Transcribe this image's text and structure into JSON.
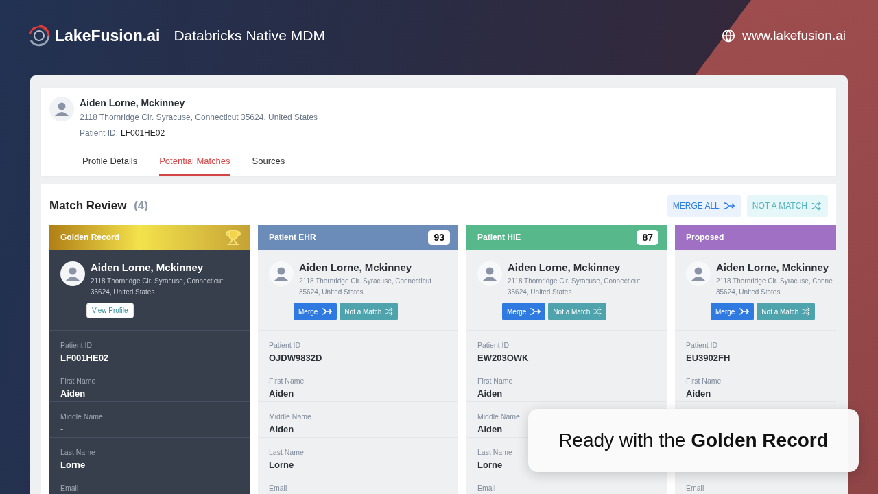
{
  "brand": {
    "name": "LakeFusion.ai",
    "tagline": "Databricks Native MDM",
    "website": "www.lakefusion.ai"
  },
  "profile": {
    "name": "Aiden Lorne, Mckinney",
    "address": "2118 Thornridge Cir. Syracuse, Connecticut 35624, United States",
    "id_label": "Patient ID:",
    "id_value": "LF001HE02"
  },
  "tabs": [
    {
      "label": "Profile Details",
      "selected": false
    },
    {
      "label": "Potential Matches",
      "selected": true
    },
    {
      "label": "Sources",
      "selected": false
    }
  ],
  "match_review": {
    "title": "Match Review",
    "count": "(4)",
    "actions": [
      {
        "kind": "merge",
        "label": "MERGE ALL"
      },
      {
        "kind": "reject",
        "label": "NOT A MATCH"
      }
    ]
  },
  "cards": [
    {
      "kind": "golden",
      "title": "Golden Record",
      "color": "#c9a227",
      "name": "Aiden Lorne, Mckinney",
      "name_underlined": false,
      "address_lines": [
        "2118 Thornridge Cir. Syracuse, Connecticut",
        "35624, United States"
      ],
      "button": "View Profile",
      "fields": [
        {
          "label": "Patient ID",
          "value": "LF001HE02"
        },
        {
          "label": "First Name",
          "value": "Aiden"
        },
        {
          "label": "Middle Name",
          "value": "-"
        },
        {
          "label": "Last Name",
          "value": "Lorne"
        },
        {
          "label": "Email"
        }
      ]
    },
    {
      "kind": "source",
      "title": "Patient EHR",
      "color": "#6b8bb8",
      "score": "93",
      "name": "Aiden Lorne, Mckinney",
      "name_underlined": false,
      "address_lines": [
        "2118 Thornridge Cir. Syracuse, Connecticut",
        "35624, United States"
      ],
      "merge": "Merge",
      "reject": "Not a Match",
      "fields": [
        {
          "label": "Patient ID",
          "value": "OJDW9832D"
        },
        {
          "label": "First Name",
          "value": "Aiden"
        },
        {
          "label": "Middle Name",
          "value": "Aiden"
        },
        {
          "label": "Last Name",
          "value": "Lorne"
        },
        {
          "label": "Email"
        }
      ]
    },
    {
      "kind": "source",
      "title": "Patient HIE",
      "color": "#57b88c",
      "score": "87",
      "name": "Aiden Lorne, Mckinney",
      "name_underlined": true,
      "address_lines": [
        "2118 Thornridge Cir. Syracuse, Connecticut",
        "35624, United States"
      ],
      "merge": "Merge",
      "reject": "Not a Match",
      "fields": [
        {
          "label": "Patient ID",
          "value": "EW203OWK"
        },
        {
          "label": "First Name",
          "value": "Aiden"
        },
        {
          "label": "Middle Name",
          "value": "Aiden"
        },
        {
          "label": "Last Name",
          "value": "Lorne"
        },
        {
          "label": "Email"
        }
      ]
    },
    {
      "kind": "source",
      "title": "Proposed",
      "color": "#a070c4",
      "name": "Aiden Lorne, Mckinney",
      "name_underlined": false,
      "address_lines": [
        "2118 Thornridge Cir. Syracuse, Conne",
        "35624, United States"
      ],
      "merge": "Merge",
      "reject": "Not a Match",
      "fields": [
        {
          "label": "Patient ID",
          "value": "EU3902FH"
        },
        {
          "label": "First Name",
          "value": "Aiden"
        },
        {
          "kind": "covered"
        },
        {
          "kind": "covered"
        },
        {
          "label": "Email"
        }
      ]
    }
  ],
  "callout": "Ready with the **Golden Record**"
}
